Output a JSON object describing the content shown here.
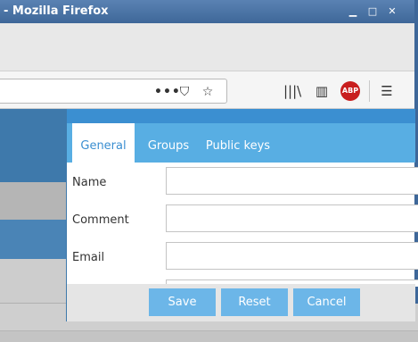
{
  "window": {
    "title": "- Mozilla Firefox",
    "minimize_icon": "minimize-icon",
    "maximize_icon": "maximize-icon",
    "close_icon": "close-icon"
  },
  "toolbar": {
    "page_actions_glyph": "•••",
    "pocket_glyph": "⛉",
    "bookmark_glyph": "☆",
    "library_glyph": "|||\\",
    "sidebar_glyph": "▥",
    "abp_label": "ABP",
    "menu_glyph": "☰"
  },
  "dialog": {
    "tabs": [
      {
        "label": "General",
        "active": true
      },
      {
        "label": "Groups",
        "active": false
      },
      {
        "label": "Public keys",
        "active": false
      }
    ],
    "fields": [
      {
        "label": "Name",
        "value": ""
      },
      {
        "label": "Comment",
        "value": ""
      },
      {
        "label": "Email",
        "value": ""
      }
    ],
    "buttons": {
      "save": "Save",
      "reset": "Reset",
      "cancel": "Cancel"
    }
  },
  "colors": {
    "titlebar": "#3e6799",
    "dialog_header": "#3b8fd1",
    "tab_bar": "#58aee3",
    "button": "#6cb6e8"
  }
}
